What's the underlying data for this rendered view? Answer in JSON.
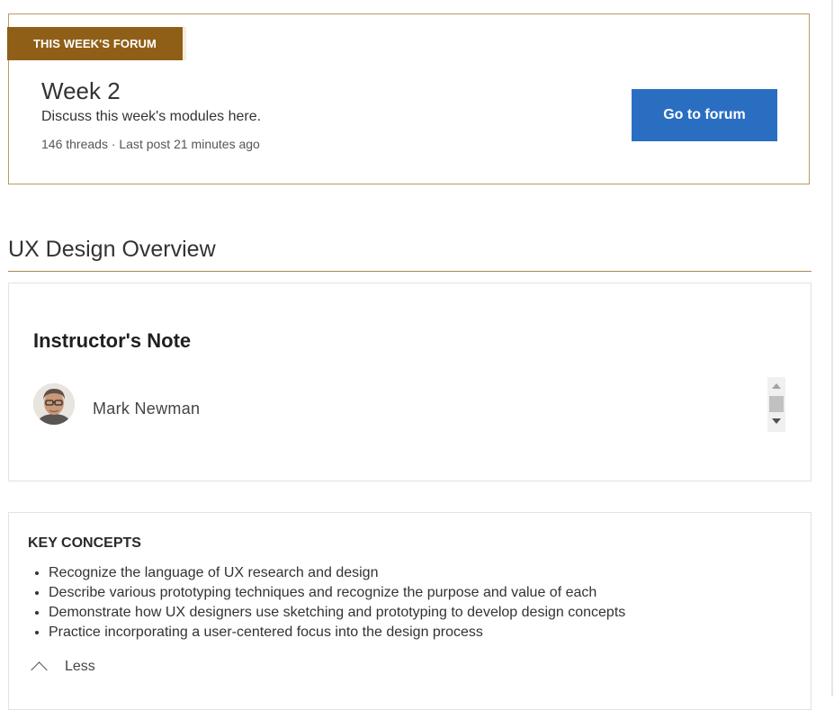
{
  "forum": {
    "badge": "THIS WEEK'S FORUM",
    "title": "Week 2",
    "description": "Discuss this week's modules here.",
    "meta": "146 threads · Last post 21 minutes ago",
    "button_label": "Go to forum"
  },
  "section": {
    "title": "UX Design Overview"
  },
  "instructor": {
    "heading": "Instructor's Note",
    "name": "Mark Newman"
  },
  "concepts": {
    "heading": "KEY CONCEPTS",
    "items": [
      "Recognize the language of UX research and design",
      "Describe various prototyping techniques and recognize the purpose and value of each",
      "Demonstrate how UX designers use sketching and prototyping to develop design concepts",
      "Practice incorporating a user-centered focus into the design process"
    ],
    "toggle_label": "Less"
  },
  "colors": {
    "accent_gold": "#8f5f17",
    "button_blue": "#2a6ec2",
    "border_tan": "#b89b6a"
  }
}
